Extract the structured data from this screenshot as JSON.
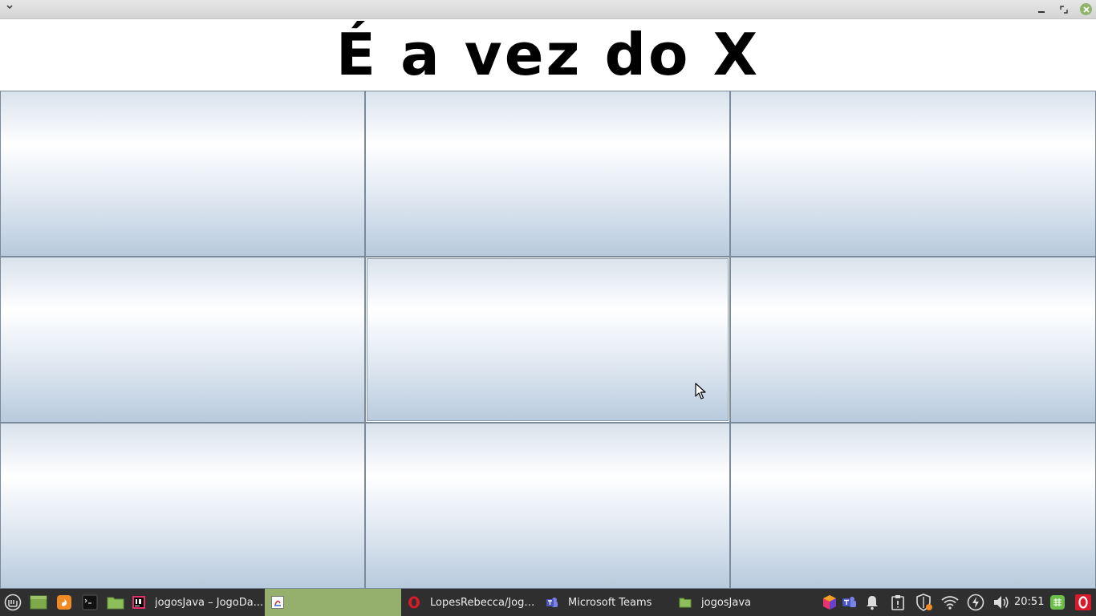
{
  "window": {
    "title": "",
    "controls": {
      "menu": "chevron-down",
      "minimize": "minimize",
      "maximize": "maximize",
      "close": "close"
    }
  },
  "game": {
    "turn_text": "É a vez do X",
    "board": [
      {
        "row": 1,
        "col": 1,
        "mark": ""
      },
      {
        "row": 1,
        "col": 2,
        "mark": ""
      },
      {
        "row": 1,
        "col": 3,
        "mark": ""
      },
      {
        "row": 2,
        "col": 1,
        "mark": ""
      },
      {
        "row": 2,
        "col": 2,
        "mark": ""
      },
      {
        "row": 2,
        "col": 3,
        "mark": ""
      },
      {
        "row": 3,
        "col": 1,
        "mark": ""
      },
      {
        "row": 3,
        "col": 2,
        "mark": ""
      },
      {
        "row": 3,
        "col": 3,
        "mark": ""
      }
    ]
  },
  "taskbar": {
    "launchers": [
      "mint-menu-icon",
      "show-desktop-icon",
      "firefox-icon",
      "terminal-icon",
      "files-icon"
    ],
    "tasks": [
      {
        "label": "jogosJava – JogoDa...",
        "icon": "intellij-icon",
        "active": false
      },
      {
        "label": "",
        "icon": "java-app-icon",
        "active": true
      },
      {
        "label": "LopesRebecca/JogoD...",
        "icon": "opera-icon",
        "active": false
      },
      {
        "label": "Microsoft Teams",
        "icon": "teams-icon",
        "active": false
      },
      {
        "label": "jogosJava",
        "icon": "folder-icon",
        "active": false
      }
    ],
    "tray": [
      "app-cube-icon",
      "teams-tray-icon",
      "notifications-icon",
      "clipboard-icon",
      "shield-icon",
      "wifi-icon",
      "power-icon",
      "volume-icon"
    ],
    "clock": "20:51",
    "tray_right": [
      "grid-app-icon",
      "opera-tray-icon"
    ]
  },
  "colors": {
    "titlebar": "#d9d9d9",
    "cell_border": "#7a8a9a",
    "taskbar_bg": "#2f2f2f",
    "taskbar_active": "#94b06c",
    "close_button": "#8fb468"
  }
}
